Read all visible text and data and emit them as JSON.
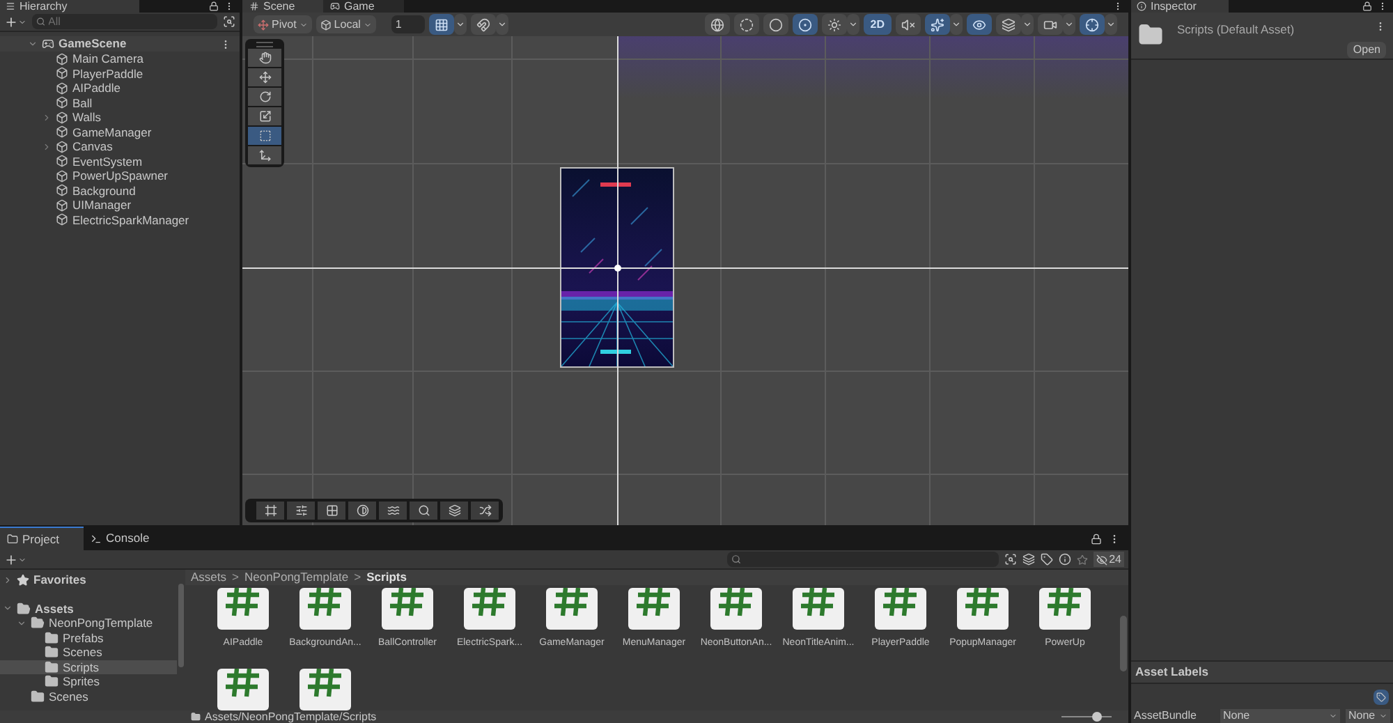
{
  "hierarchy": {
    "tab": "Hierarchy",
    "search": {
      "placeholder": "All"
    },
    "scene": {
      "name": "GameScene",
      "expanded": true,
      "children": [
        {
          "name": "Main Camera",
          "expandable": false
        },
        {
          "name": "PlayerPaddle",
          "expandable": false
        },
        {
          "name": "AIPaddle",
          "expandable": false
        },
        {
          "name": "Ball",
          "expandable": false
        },
        {
          "name": "Walls",
          "expandable": true
        },
        {
          "name": "GameManager",
          "expandable": false
        },
        {
          "name": "Canvas",
          "expandable": true
        },
        {
          "name": "EventSystem",
          "expandable": false
        },
        {
          "name": "PowerUpSpawner",
          "expandable": false
        },
        {
          "name": "Background",
          "expandable": false
        },
        {
          "name": "UIManager",
          "expandable": false
        },
        {
          "name": "ElectricSparkManager",
          "expandable": false
        }
      ]
    }
  },
  "scene_view": {
    "tabs": [
      {
        "label": "Scene",
        "kind": "scene",
        "selected": true
      },
      {
        "label": "Game",
        "kind": "game",
        "selected": false
      }
    ],
    "pivot": "Pivot",
    "space": "Local",
    "grid_size": "1",
    "left_toggles": [
      {
        "kind": "grid",
        "selected": true
      },
      {
        "kind": "snap",
        "selected": false
      }
    ],
    "right_toggles": [
      {
        "kind": "globe",
        "selected": false
      },
      {
        "kind": "half",
        "selected": false
      },
      {
        "kind": "solid",
        "selected": false
      },
      {
        "kind": "outline",
        "selected": true
      },
      {
        "kind": "light",
        "selected": false
      },
      {
        "kind": "mode2d",
        "label": "2D",
        "selected": true
      },
      {
        "kind": "audio",
        "selected": false
      },
      {
        "kind": "effects",
        "selected": true
      },
      {
        "kind": "visibility",
        "selected": true
      },
      {
        "kind": "layers",
        "selected": false
      },
      {
        "kind": "camera",
        "selected": false
      },
      {
        "kind": "gizmos",
        "selected": true
      }
    ],
    "tools": [
      {
        "kind": "hand",
        "selected": false
      },
      {
        "kind": "move",
        "selected": false
      },
      {
        "kind": "rotate",
        "selected": false
      },
      {
        "kind": "scale",
        "selected": false
      },
      {
        "kind": "rect",
        "selected": true
      },
      {
        "kind": "transform",
        "selected": false
      }
    ],
    "overlay_tools": [
      {
        "kind": "frame"
      },
      {
        "kind": "sliders"
      },
      {
        "kind": "grid"
      },
      {
        "kind": "contrast"
      },
      {
        "kind": "waves"
      },
      {
        "kind": "search"
      },
      {
        "kind": "layers"
      },
      {
        "kind": "shuffle"
      }
    ]
  },
  "inspector": {
    "tab": "Inspector",
    "title": "Scripts (Default Asset)",
    "open_button": "Open",
    "asset_labels": "Asset Labels",
    "asset_bundle": {
      "label": "AssetBundle",
      "value": "None",
      "variant": "None"
    }
  },
  "project": {
    "tabs": [
      {
        "label": "Project",
        "kind": "project",
        "selected": true
      },
      {
        "label": "Console",
        "kind": "console",
        "selected": false
      }
    ],
    "hidden_count": "24",
    "tree": [
      {
        "name": "Favorites",
        "kind": "favorites",
        "expanded": false,
        "selected": false
      },
      {
        "name": "Assets",
        "kind": "folder",
        "expanded": true,
        "selected": false,
        "children": [
          {
            "name": "NeonPongTemplate",
            "kind": "folder",
            "expanded": true,
            "selected": false,
            "children": [
              {
                "name": "Prefabs",
                "kind": "folder",
                "selected": false
              },
              {
                "name": "Scenes",
                "kind": "folder",
                "selected": false
              },
              {
                "name": "Scripts",
                "kind": "folder",
                "selected": true
              },
              {
                "name": "Sprites",
                "kind": "folder",
                "selected": false
              }
            ]
          },
          {
            "name": "Scenes",
            "kind": "folder",
            "selected": false
          }
        ]
      }
    ],
    "breadcrumb": {
      "separator": ">",
      "items": [
        "Assets",
        "NeonPongTemplate",
        "Scripts"
      ]
    },
    "assets": [
      {
        "kind": "script",
        "name": "AIPaddle"
      },
      {
        "kind": "script",
        "name": "BackgroundAn..."
      },
      {
        "kind": "script",
        "name": "BallController"
      },
      {
        "kind": "script",
        "name": "ElectricSpark..."
      },
      {
        "kind": "script",
        "name": "GameManager"
      },
      {
        "kind": "script",
        "name": "MenuManager"
      },
      {
        "kind": "script",
        "name": "NeonButtonAn..."
      },
      {
        "kind": "script",
        "name": "NeonTitleAnim..."
      },
      {
        "kind": "script",
        "name": "PlayerPaddle"
      },
      {
        "kind": "script",
        "name": "PopupManager"
      },
      {
        "kind": "script",
        "name": "PowerUp"
      },
      {
        "kind": "script"
      },
      {
        "kind": "script"
      }
    ],
    "path": "Assets/NeonPongTemplate/Scripts",
    "zoom": {
      "level": 0.75
    }
  }
}
